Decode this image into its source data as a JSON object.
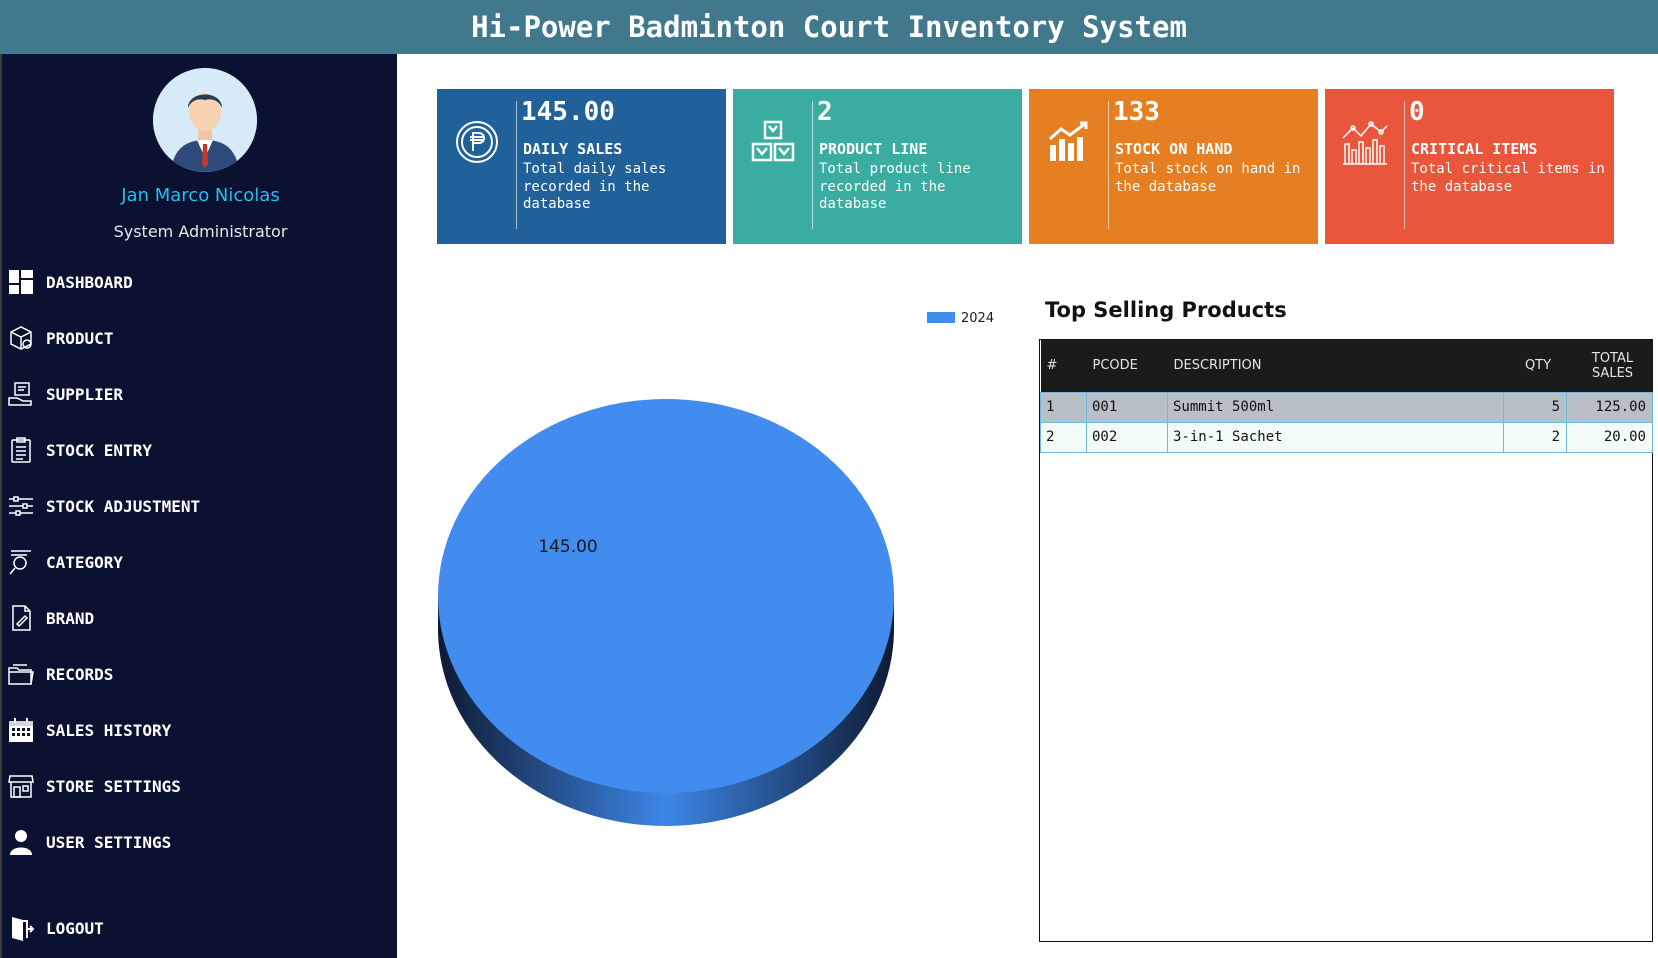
{
  "app": {
    "title": "Hi-Power Badminton Court Inventory System"
  },
  "user": {
    "name": "Jan Marco Nicolas",
    "role": "System Administrator"
  },
  "nav": [
    {
      "label": "DASHBOARD",
      "icon": "dashboard-icon"
    },
    {
      "label": "PRODUCT",
      "icon": "box-icon"
    },
    {
      "label": "SUPPLIER",
      "icon": "supplier-icon"
    },
    {
      "label": "STOCK ENTRY",
      "icon": "clipboard-icon"
    },
    {
      "label": "STOCK ADJUSTMENT",
      "icon": "sliders-icon"
    },
    {
      "label": "CATEGORY",
      "icon": "category-search-icon"
    },
    {
      "label": "BRAND",
      "icon": "brand-document-icon"
    },
    {
      "label": "RECORDS",
      "icon": "folder-icon"
    },
    {
      "label": "SALES HISTORY",
      "icon": "calendar-icon"
    },
    {
      "label": "STORE SETTINGS",
      "icon": "store-icon"
    },
    {
      "label": "USER SETTINGS",
      "icon": "user-icon"
    },
    {
      "label": "LOGOUT",
      "icon": "logout-icon"
    }
  ],
  "cards": [
    {
      "value": "145.00",
      "title": "DAILY SALES",
      "desc": "Total daily sales recorded in the database",
      "color": "#20619a",
      "icon": "peso-coin-icon"
    },
    {
      "value": "2",
      "title": "PRODUCT LINE",
      "desc": "Total product line recorded in the database",
      "color": "#3bada0",
      "icon": "boxes-icon"
    },
    {
      "value": "133",
      "title": "STOCK ON HAND",
      "desc": "Total stock on hand in the database",
      "color": "#e67e22",
      "icon": "bar-chart-icon"
    },
    {
      "value": "0",
      "title": "CRITICAL ITEMS",
      "desc": "Total critical items in the database",
      "color": "#ea563b",
      "icon": "critical-chart-icon"
    }
  ],
  "chart_data": {
    "type": "pie",
    "categories": [
      "2024"
    ],
    "values": [
      145.0
    ],
    "labels": [
      "145.00"
    ],
    "legend": "top-right",
    "colors": [
      "#428bef"
    ]
  },
  "top_selling": {
    "title": "Top Selling Products",
    "columns": [
      "#",
      "PCODE",
      "DESCRIPTION",
      "QTY",
      "TOTAL SALES"
    ],
    "rows": [
      [
        "1",
        "001",
        "Summit 500ml",
        "5",
        "125.00"
      ],
      [
        "2",
        "002",
        "3-in-1 Sachet",
        "2",
        "20.00"
      ]
    ]
  }
}
